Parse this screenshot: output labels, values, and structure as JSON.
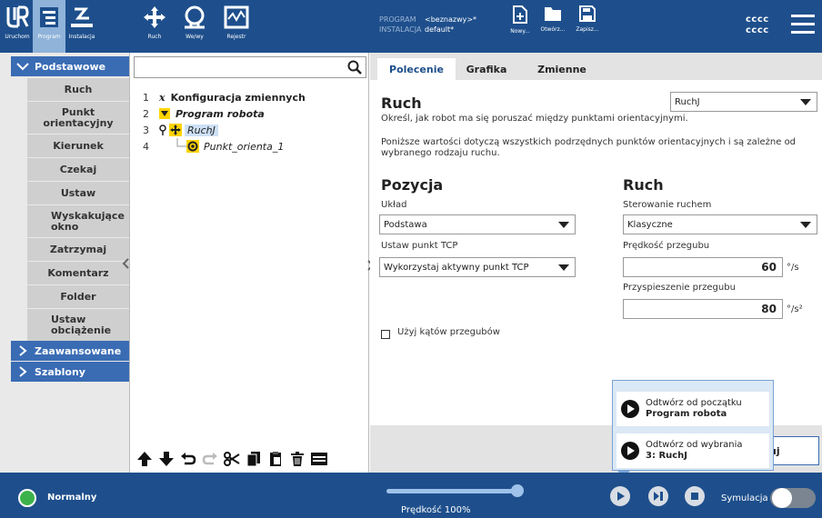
{
  "topbar": {
    "nav": [
      {
        "label": "Uruchom",
        "icon": "ur-logo-icon"
      },
      {
        "label": "Program",
        "icon": "program-icon"
      },
      {
        "label": "Instalacja",
        "icon": "installation-icon"
      },
      {
        "label": "Ruch",
        "icon": "move-icon"
      },
      {
        "label": "We/wy",
        "icon": "io-icon"
      },
      {
        "label": "Rejestr",
        "icon": "log-icon"
      }
    ],
    "program_key": "PROGRAM",
    "program_value": "<beznazwy>*",
    "installation_key": "INSTALACJA",
    "installation_value": "default*",
    "file_buttons": [
      {
        "label": "Nowy...",
        "icon": "new-file-icon"
      },
      {
        "label": "Otwórz...",
        "icon": "open-folder-icon"
      },
      {
        "label": "Zapisz...",
        "icon": "save-icon"
      }
    ],
    "user_line1": "cccc",
    "user_line2": "cccc"
  },
  "sidebar": {
    "categories": [
      {
        "label": "Podstawowe",
        "expanded": true
      },
      {
        "label": "Zaawansowane",
        "expanded": false
      },
      {
        "label": "Szablony",
        "expanded": false
      }
    ],
    "items": [
      "Ruch",
      "Punkt orientacyjny",
      "Kierunek",
      "Czekaj",
      "Ustaw",
      "Wyskakujące okno",
      "Zatrzymaj",
      "Komentarz",
      "Folder",
      "Ustaw obciążenie"
    ]
  },
  "tree": {
    "search_placeholder": "",
    "rows": [
      {
        "num": "1",
        "label": "Konfiguracja zmiennych"
      },
      {
        "num": "2",
        "label": "Program robota"
      },
      {
        "num": "3",
        "label": "RuchJ"
      },
      {
        "num": "4",
        "label": "Punkt_orienta_1"
      }
    ]
  },
  "tabs": [
    "Polecenie",
    "Grafika",
    "Zmienne"
  ],
  "command": {
    "title": "Ruch",
    "move_type": "RuchJ",
    "description": "Określ, jak robot ma się poruszać między punktami orientacyjnymi.",
    "note": "Poniższe wartości dotyczą wszystkich podrzędnych punktów orientacyjnych i są zależne od wybranego rodzaju ruchu.",
    "position_heading": "Pozycja",
    "frame_label": "Układ",
    "frame_value": "Podstawa",
    "tcp_label": "Ustaw punkt TCP",
    "tcp_value": "Wykorzystaj aktywny punkt TCP",
    "motion_heading": "Ruch",
    "control_label": "Sterowanie ruchem",
    "control_value": "Klasyczne",
    "speed_label": "Prędkość przegubu",
    "speed_value": "60",
    "speed_unit": "°/s",
    "accel_label": "Przyspieszenie przegubu",
    "accel_value": "80",
    "accel_unit": "°/s²",
    "joint_angles_label": "Użyj kątów przegubów",
    "joint_angles_checked": false,
    "partial_button": "uj"
  },
  "play_popup": {
    "item1_line1": "Odtwórz od początku",
    "item1_line2": "Program robota",
    "item2_line1": "Odtwórz od wybrania",
    "item2_line2": "3: RuchJ"
  },
  "bottombar": {
    "status": "Normalny",
    "status_color": "#3cb34a",
    "speed_label": "Prędkość 100%",
    "speed_fraction": 1.0,
    "simulation_label": "Symulacja",
    "simulation_on": false
  }
}
